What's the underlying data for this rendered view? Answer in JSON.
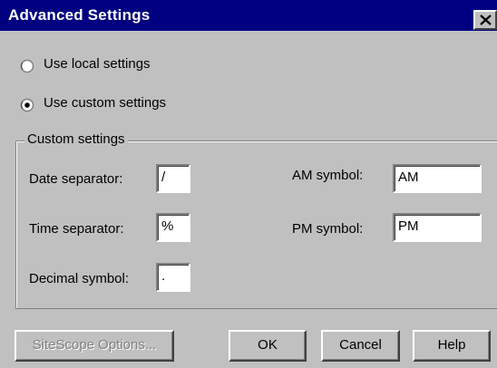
{
  "window": {
    "title": "Advanced Settings",
    "close_icon": "close-icon"
  },
  "mode": {
    "local_label": "Use local settings",
    "custom_label": "Use custom settings",
    "selected": "custom"
  },
  "custom_settings": {
    "legend": "Custom settings",
    "date_separator": {
      "label": "Date separator:",
      "value": "/"
    },
    "time_separator": {
      "label": "Time separator:",
      "value": "%"
    },
    "decimal_symbol": {
      "label": "Decimal symbol:",
      "value": "."
    },
    "am_symbol": {
      "label": "AM symbol:",
      "value": "AM"
    },
    "pm_symbol": {
      "label": "PM symbol:",
      "value": "PM"
    }
  },
  "buttons": {
    "sitescope": {
      "label": "SiteScope Options...",
      "enabled": false
    },
    "ok": {
      "label": "OK"
    },
    "cancel": {
      "label": "Cancel"
    },
    "help": {
      "label": "Help"
    }
  },
  "colors": {
    "title_bar": "#000080",
    "dialog_face": "#c0c0c0",
    "disabled_text": "#808080"
  }
}
